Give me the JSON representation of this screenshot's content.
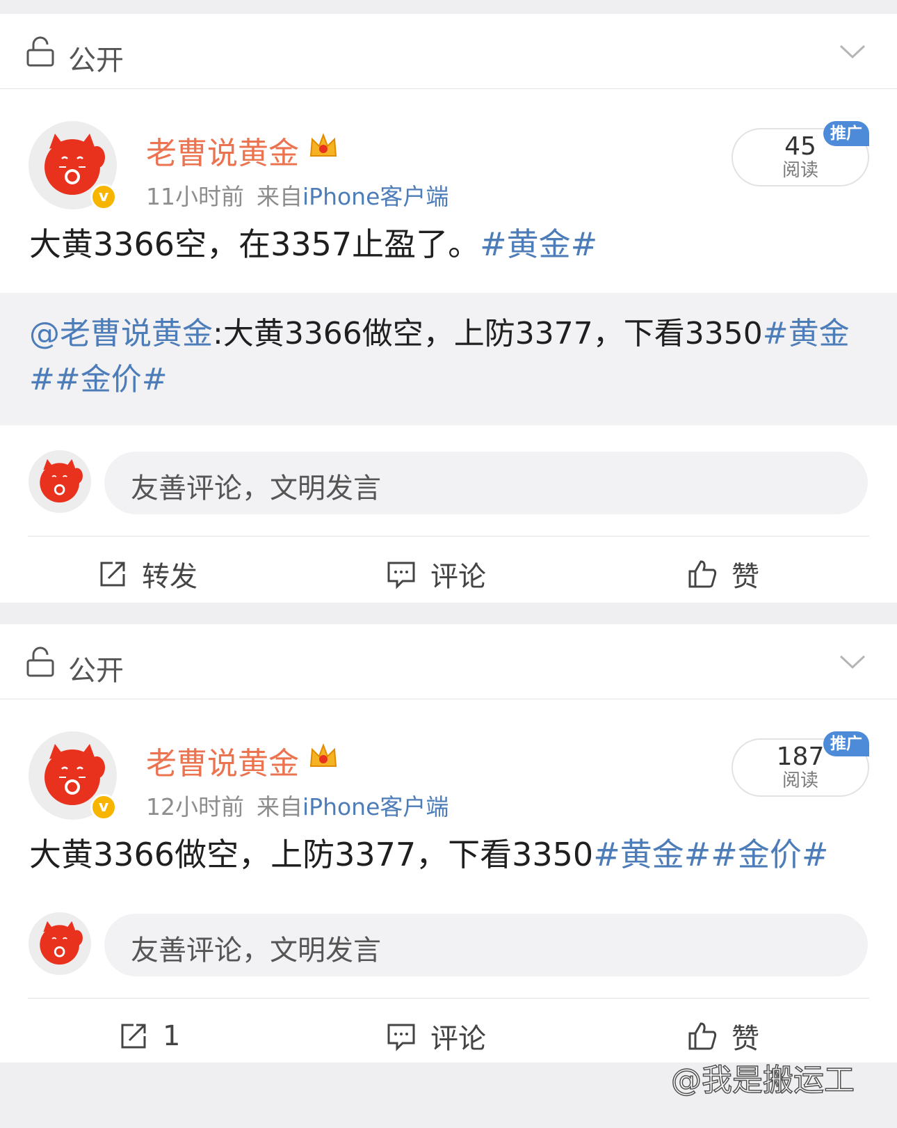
{
  "posts": [
    {
      "visibility": "公开",
      "username": "老曹说黄金",
      "time": "11小时前",
      "source_prefix": "来自",
      "device": "iPhone客户端",
      "reads_count": "45",
      "reads_label": "阅读",
      "promo": "推广",
      "text_main": "大黄3366空，在3357止盈了。",
      "text_topic": "#黄金#",
      "repost_mention": "@老曹说黄金",
      "repost_text": ":大黄3366做空，上防3377，下看3350",
      "repost_topics": "#黄金##金价#",
      "comment_placeholder": "友善评论，文明发言",
      "action_repost": "转发",
      "action_comment": "评论",
      "action_like": "赞"
    },
    {
      "visibility": "公开",
      "username": "老曹说黄金",
      "time": "12小时前",
      "source_prefix": "来自",
      "device": "iPhone客户端",
      "reads_count": "187",
      "reads_label": "阅读",
      "promo": "推广",
      "text_main": "大黄3366做空，上防3377，下看3350",
      "text_topic": "#黄金##金价#",
      "comment_placeholder": "友善评论，文明发言",
      "action_repost": "1",
      "action_comment": "评论",
      "action_like": "赞"
    }
  ],
  "watermark": "@我是搬运工",
  "colors": {
    "username": "#eb7350",
    "link": "#4d7db8",
    "promo": "#4d8bd9",
    "verified": "#f7b500",
    "page_bg": "#efeff1"
  }
}
